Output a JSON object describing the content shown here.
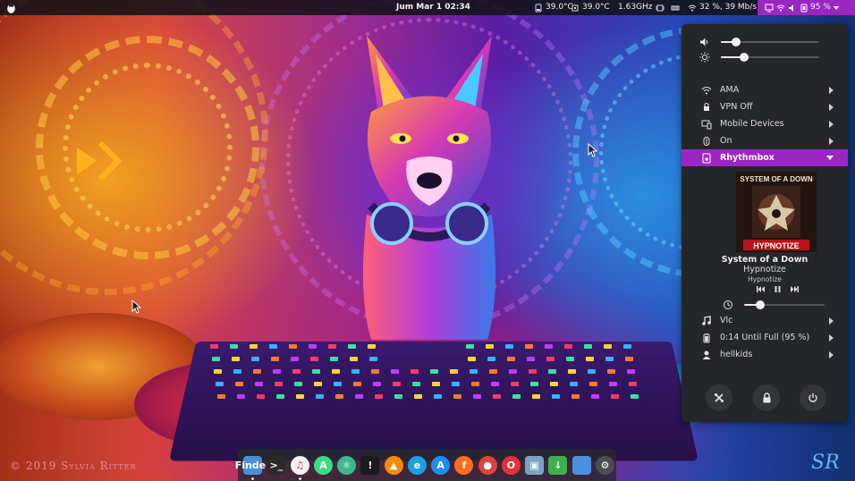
{
  "topbar": {
    "clock": "Jum Mar 1  02:34",
    "cpu_temp_1": "39.0°C",
    "cpu_temp_2": "39.0°C",
    "cpu_freq": "1.63GHz",
    "network": "32 %, 39 Mb/s",
    "battery": "95 %"
  },
  "sliders": {
    "volume_level": 0.15,
    "brightness_level": 0.24
  },
  "menu": {
    "wifi": "AMA",
    "vpn": "VPN Off",
    "mobile_devices": "Mobile Devices",
    "bluetooth": "On",
    "media_player": "Rhythmbox",
    "vlc": "Vlc",
    "power": "0:14 Until Full (95 %)",
    "user": "hellkids"
  },
  "media": {
    "artist": "System of a Down",
    "title": "Hypnotize",
    "album": "Hypnotize",
    "album_art_band": "SYSTEM OF A DOWN",
    "album_art_title": "HYPNOTIZE",
    "position": 0.2
  },
  "wallpaper": {
    "watermark": "© 2019 Sylvia Ritter",
    "signature": "SR"
  },
  "colors": {
    "accent": "#9b27c3",
    "menu_bg": "#24262a",
    "topbar_bg": "#121218"
  },
  "dock": [
    {
      "name": "files",
      "label": "Finder",
      "color": "#4a90d9",
      "running": true
    },
    {
      "name": "terminal",
      "label": ">_",
      "color": "#2b2b2b",
      "running": false
    },
    {
      "name": "music",
      "label": "♫",
      "color": "#f2f2f2",
      "running": true
    },
    {
      "name": "android-studio",
      "label": "A",
      "color": "#3ddc84",
      "running": false
    },
    {
      "name": "atom",
      "label": "⚛",
      "color": "#3fb68b",
      "running": false
    },
    {
      "name": "inkscape",
      "label": "!",
      "color": "#1b1b1b",
      "running": false
    },
    {
      "name": "vlc",
      "label": "▲",
      "color": "#ff8800",
      "running": false
    },
    {
      "name": "browser-edge",
      "label": "e",
      "color": "#1a9fe0",
      "running": false
    },
    {
      "name": "app-store",
      "label": "A",
      "color": "#1d8ff0",
      "running": false
    },
    {
      "name": "firefox",
      "label": "f",
      "color": "#ff6d1f",
      "running": false
    },
    {
      "name": "chrome",
      "label": "●",
      "color": "#de4437",
      "running": false
    },
    {
      "name": "opera",
      "label": "O",
      "color": "#e5303c",
      "running": false
    },
    {
      "name": "image-viewer",
      "label": "▣",
      "color": "#7aa3c7",
      "running": false
    },
    {
      "name": "downloads",
      "label": "↓",
      "color": "#3fae4e",
      "running": false
    },
    {
      "name": "window",
      "label": "",
      "color": "#4b8fe0",
      "running": false
    },
    {
      "name": "settings",
      "label": "⚙",
      "color": "#4d4d4d",
      "running": false
    }
  ]
}
